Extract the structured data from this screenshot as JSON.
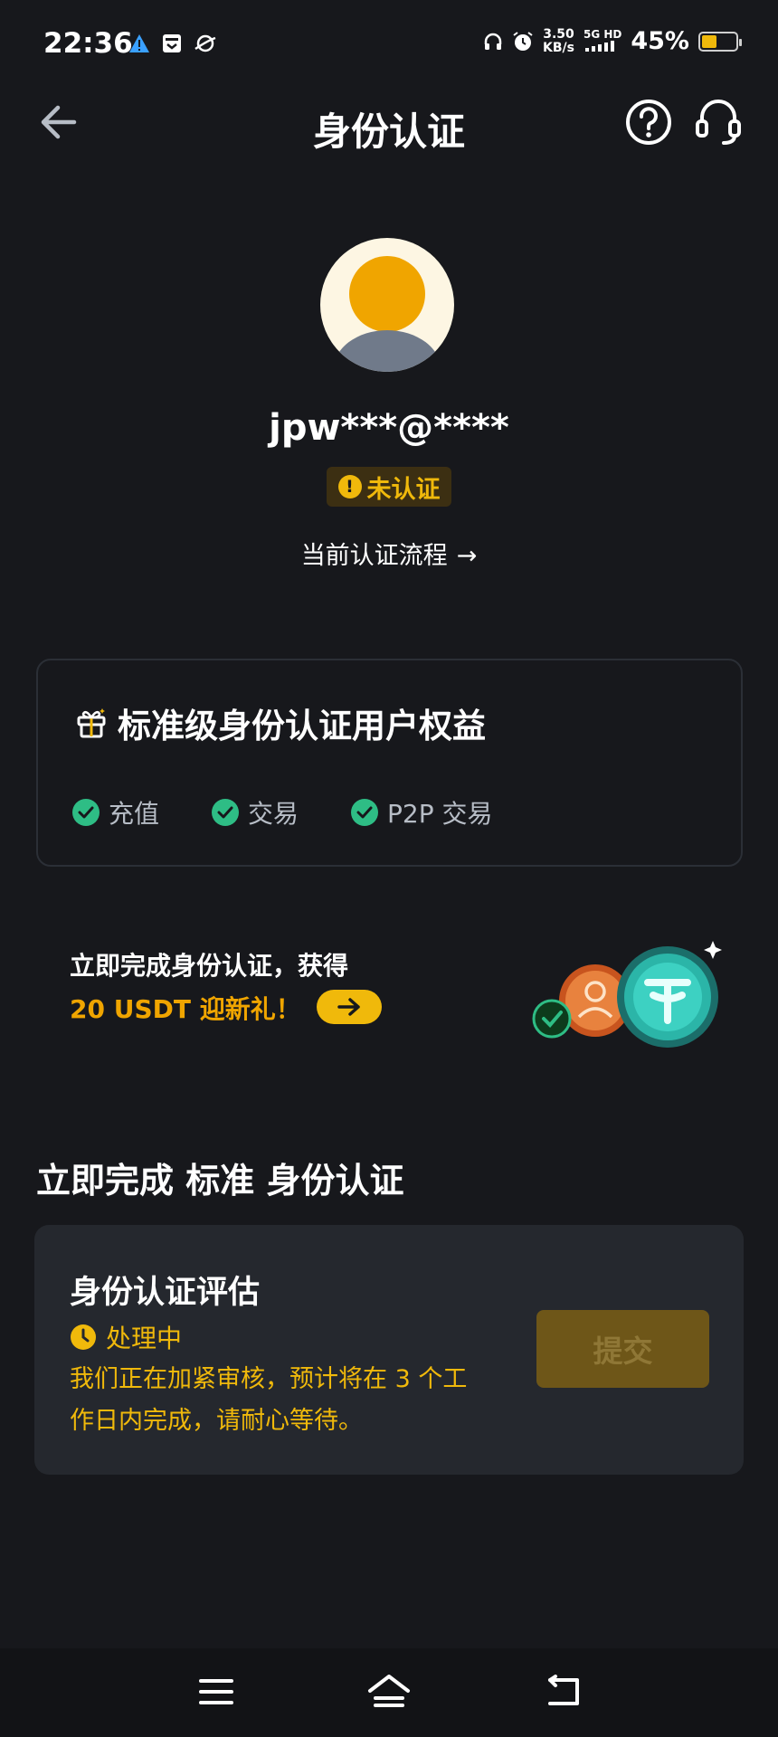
{
  "status_bar": {
    "time": "22:36",
    "speed_value": "3.50",
    "speed_unit": "KB/s",
    "network_top": "5G HD",
    "battery_percent": "45%",
    "battery_level": 0.45,
    "icons": [
      "warning-icon",
      "store-icon",
      "planet-icon",
      "headphones-icon",
      "alarm-icon",
      "signal-icon",
      "battery-icon"
    ]
  },
  "header": {
    "title": "身份认证",
    "icons": [
      "back-arrow-icon",
      "help-icon",
      "headset-icon"
    ]
  },
  "profile": {
    "username": "jpw***@****",
    "status_label": "未认证",
    "process_link": "当前认证流程",
    "process_arrow": "→"
  },
  "benefits": {
    "title": "标准级身份认证用户权益",
    "items": [
      "充值",
      "交易",
      "P2P 交易"
    ]
  },
  "promo": {
    "line1": "立即完成身份认证，获得",
    "line2": "20 USDT 迎新礼！"
  },
  "section": {
    "title": "立即完成 标准 身份认证"
  },
  "evaluation": {
    "title": "身份认证评估",
    "status": "处理中",
    "description": "我们正在加紧审核，预计将在 3 个工作日内完成，请耐心等待。",
    "submit_label": "提交"
  },
  "colors": {
    "background": "#17181c",
    "accent": "#f0b90b",
    "success": "#2ebd85",
    "card": "#25282e"
  }
}
